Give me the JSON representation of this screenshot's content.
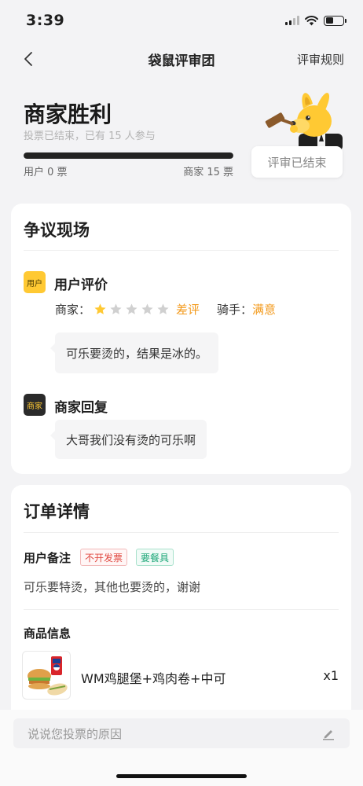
{
  "status_bar": {
    "time": "3:39"
  },
  "nav": {
    "title": "袋鼠评审团",
    "rules_label": "评审规则"
  },
  "verdict": {
    "title": "商家胜利",
    "subtitle": "投票已结束，已有 15 人参与",
    "user_votes_label": "用户 0 票",
    "merchant_votes_label": "商家 15 票",
    "merchant_vote_fraction": 1.0,
    "status_button": "评审已结束"
  },
  "dispute": {
    "title": "争议现场",
    "user_tag": "用户",
    "user_heading": "用户评价",
    "merchant_label": "商家：",
    "star_rating": 1,
    "star_max": 5,
    "rating_text": "差评",
    "rider_label": "骑手：",
    "rider_value": "满意",
    "user_comment": "可乐要烫的，结果是冰的。",
    "merchant_tag": "商家",
    "merchant_heading": "商家回复",
    "merchant_reply": "大哥我们没有烫的可乐啊"
  },
  "order": {
    "title": "订单详情",
    "remark_label": "用户备注",
    "chip_invoice": "不开发票",
    "chip_utensils": "要餐具",
    "remark_text": "可乐要特烫，其他也要烫的，谢谢",
    "goods_label": "商品信息",
    "product_name": "WM鸡腿堡+鸡肉卷+中可",
    "product_qty": "x1"
  },
  "bottom": {
    "input_placeholder": "说说您投票的原因"
  },
  "colors": {
    "accent_yellow": "#ffc933",
    "rating_orange": "#f39a1c"
  },
  "icons": [
    "back-arrow-icon",
    "signal-icon",
    "wifi-icon",
    "battery-icon",
    "star-icon",
    "pencil-icon"
  ]
}
